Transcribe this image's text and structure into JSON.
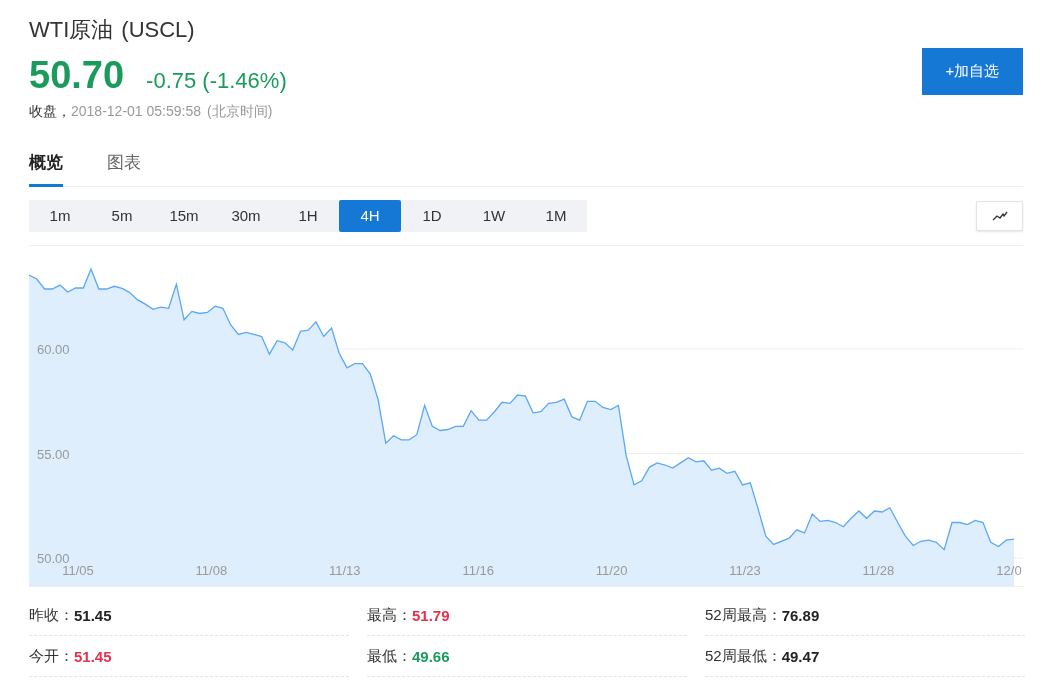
{
  "quote": {
    "name": "WTI原油",
    "code": "(USCL)",
    "price": "50.70",
    "change": "-0.75 (-1.46%)",
    "close_label": "收盘，",
    "timestamp": "2018-12-01 05:59:58",
    "timezone": "(北京时间)"
  },
  "add_button": "+加自选",
  "tabs": [
    {
      "label": "概览",
      "selected": true
    },
    {
      "label": "图表",
      "selected": false
    }
  ],
  "periods": [
    {
      "label": "1m",
      "selected": false
    },
    {
      "label": "5m",
      "selected": false
    },
    {
      "label": "15m",
      "selected": false
    },
    {
      "label": "30m",
      "selected": false
    },
    {
      "label": "1H",
      "selected": false
    },
    {
      "label": "4H",
      "selected": true
    },
    {
      "label": "1D",
      "selected": false
    },
    {
      "label": "1W",
      "selected": false
    },
    {
      "label": "1M",
      "selected": false
    }
  ],
  "chart": {
    "chart_data": {
      "type": "area",
      "ylim": [
        48.66,
        64.93
      ],
      "grid": true,
      "yticks": [
        {
          "value": 50,
          "label": "50.00"
        },
        {
          "value": 55,
          "label": "55.00"
        },
        {
          "value": 60,
          "label": "60.00"
        }
      ],
      "series": [
        {
          "color": "#5aa8f5",
          "values": [
            63.54,
            63.35,
            62.87,
            62.87,
            63.06,
            62.73,
            62.92,
            62.92,
            63.83,
            62.87,
            62.87,
            63.0,
            62.9,
            62.7,
            62.35,
            62.15,
            61.9,
            62.0,
            61.95,
            63.1,
            61.4,
            61.8,
            61.7,
            61.75,
            62.05,
            61.95,
            61.15,
            60.7,
            60.8,
            60.7,
            60.6,
            59.75,
            60.4,
            60.3,
            59.95,
            60.85,
            60.9,
            61.3,
            60.6,
            61.0,
            59.8,
            59.1,
            59.3,
            59.3,
            58.8,
            57.6,
            55.5,
            55.85,
            55.65,
            55.65,
            55.9,
            57.3,
            56.3,
            56.1,
            56.15,
            56.3,
            56.3,
            57.05,
            56.6,
            56.6,
            57.0,
            57.45,
            57.4,
            57.8,
            57.75,
            56.95,
            57.0,
            57.4,
            57.45,
            57.6,
            56.75,
            56.6,
            57.5,
            57.5,
            57.2,
            57.1,
            57.3,
            54.9,
            53.5,
            53.7,
            54.35,
            54.55,
            54.45,
            54.3,
            54.55,
            54.8,
            54.6,
            54.65,
            54.2,
            54.3,
            54.05,
            54.15,
            53.5,
            53.6,
            52.35,
            51.05,
            50.65,
            50.8,
            50.95,
            51.35,
            51.2,
            52.1,
            51.75,
            51.8,
            51.7,
            51.5,
            51.9,
            52.25,
            51.9,
            52.25,
            52.2,
            52.4,
            51.7,
            51.05,
            50.6,
            50.8,
            50.85,
            50.75,
            50.4,
            51.7,
            51.7,
            51.6,
            51.8,
            51.7,
            50.75,
            50.55,
            50.85,
            50.9
          ]
        }
      ]
    },
    "x_axis_labels": [
      "11/05",
      "11/08",
      "11/13",
      "11/16",
      "11/20",
      "11/23",
      "11/28",
      "12/0"
    ]
  },
  "stats": [
    {
      "label": "昨收：",
      "value": "51.45",
      "color": "#222222"
    },
    {
      "label": "最高：",
      "value": "51.79",
      "color": "#e8304a"
    },
    {
      "label": "52周最高：",
      "value": "76.89",
      "color": "#222222"
    },
    {
      "label": "今开：",
      "value": "51.45",
      "color": "#e8304a"
    },
    {
      "label": "最低：",
      "value": "49.66",
      "color": "#1a9b5b"
    },
    {
      "label": "52周最低：",
      "value": "49.47",
      "color": "#222222"
    }
  ]
}
